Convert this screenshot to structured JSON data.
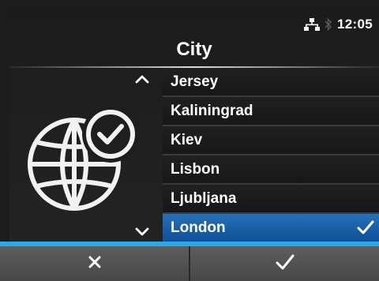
{
  "status_bar": {
    "time": "12:05",
    "icons": [
      "network-icon",
      "bluetooth-icon"
    ]
  },
  "header": {
    "title": "City"
  },
  "list": {
    "items": [
      {
        "label": "Jersey",
        "selected": false
      },
      {
        "label": "Kaliningrad",
        "selected": false
      },
      {
        "label": "Kiev",
        "selected": false
      },
      {
        "label": "Lisbon",
        "selected": false
      },
      {
        "label": "Ljubljana",
        "selected": false
      },
      {
        "label": "London",
        "selected": true
      }
    ],
    "scroll_icons": [
      "chevron-up-icon",
      "chevron-down-icon"
    ]
  },
  "side_icon": "globe-clock-icon",
  "footer": {
    "buttons": [
      {
        "name": "cancel",
        "icon": "close-icon"
      },
      {
        "name": "confirm",
        "icon": "check-icon"
      }
    ]
  },
  "colors": {
    "background": "#1c1c1c",
    "selection": "#1c63ad",
    "footer_accent": "#29a9e6",
    "footer_button": "#525252"
  }
}
